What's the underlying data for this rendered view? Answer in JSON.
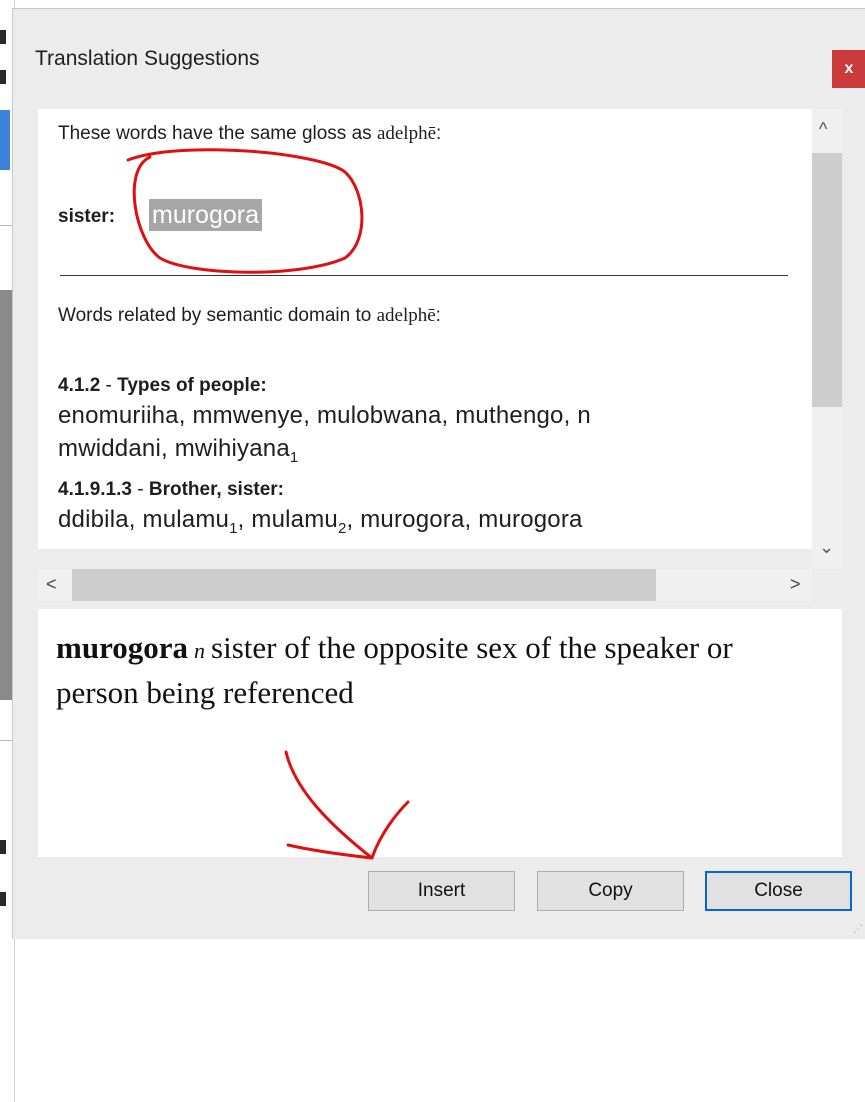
{
  "window": {
    "title": "Translation Suggestions",
    "close_glyph": "x"
  },
  "suggestions": {
    "gloss_intro_prefix": "These words have the same gloss as ",
    "gloss_word": "adelphē",
    "gloss_intro_suffix": ":",
    "gloss_label": "sister:",
    "gloss_match": "murogora",
    "domain_intro_prefix": "Words related by semantic domain to ",
    "domain_word": "adelphē",
    "domain_intro_suffix": ":",
    "domains": [
      {
        "code": "4.1.2",
        "separator": " - ",
        "name": "Types of people:",
        "line1": " enomuriiha, mmwenye, mulobwana, muthengo, n",
        "line2_pre": " mwiddani, mwihiyana",
        "line2_sub": "1"
      },
      {
        "code": "4.1.9.1.3",
        "separator": " - ",
        "name": "Brother, sister:",
        "l_a": " ddibila, mulamu",
        "l_s1": "1",
        "l_b": ", mulamu",
        "l_s2": "2",
        "l_c": ", murogora, murogora"
      }
    ]
  },
  "scroll": {
    "up_icon": "^",
    "down_icon": "⌄",
    "left_icon": "<",
    "right_icon": ">"
  },
  "definition": {
    "headword": "murogora",
    "pos": "n",
    "text": "sister of the opposite sex of the speaker or person being referenced"
  },
  "buttons": {
    "insert": "Insert",
    "copy": "Copy",
    "close": "Close"
  },
  "annotation_color": "#e01010"
}
